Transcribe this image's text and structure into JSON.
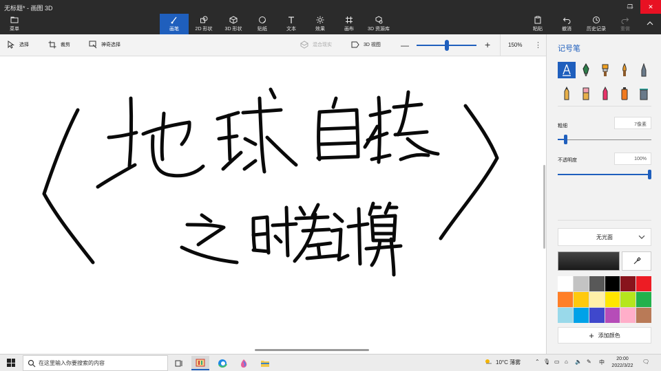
{
  "window": {
    "title": "无标题* - 画图 3D",
    "controls": {
      "minimize": "—",
      "restore": "❐",
      "close": "✕"
    }
  },
  "ribbon": {
    "menu_label": "菜单",
    "tabs": [
      {
        "label": "画笔",
        "icon": "brush-icon",
        "active": true
      },
      {
        "label": "2D 形状",
        "icon": "shapes-2d-icon"
      },
      {
        "label": "3D 形状",
        "icon": "shapes-3d-icon"
      },
      {
        "label": "贴纸",
        "icon": "sticker-icon"
      },
      {
        "label": "文本",
        "icon": "text-icon"
      },
      {
        "label": "效果",
        "icon": "effects-icon"
      },
      {
        "label": "画布",
        "icon": "canvas-icon"
      },
      {
        "label": "3D 资源库",
        "icon": "library-icon"
      }
    ],
    "right": [
      {
        "label": "粘贴",
        "icon": "paste-icon"
      },
      {
        "label": "撤消",
        "icon": "undo-icon"
      },
      {
        "label": "历史记录",
        "icon": "history-icon"
      },
      {
        "label": "重做",
        "icon": "redo-icon",
        "disabled": true
      }
    ]
  },
  "toolbar": {
    "select": "选择",
    "crop": "裁剪",
    "magic_select": "神奇选择",
    "mixed_reality": "混合现实",
    "view_3d": "3D 视图",
    "zoom_value": "150%",
    "zoom_level": 0.5
  },
  "panel": {
    "title": "记号笔",
    "tools_row1": [
      "marker-icon",
      "calligraphy-pen-icon",
      "oil-brush-icon",
      "watercolor-icon",
      "pixel-pen-icon"
    ],
    "tools_row2": [
      "pencil-icon",
      "eraser-icon",
      "crayon-icon",
      "spray-can-icon",
      "fill-bucket-icon"
    ],
    "thickness_label": "粗细",
    "thickness_value": "7像素",
    "thickness_level": 0.07,
    "opacity_label": "不透明度",
    "opacity_value": "100%",
    "opacity_level": 1.0,
    "finish_label": "无光面",
    "add_color": "添加颜色",
    "current_color": "#1a1a1a",
    "palette": [
      "#ffffff",
      "#c3c3c3",
      "#585858",
      "#000000",
      "#88141c",
      "#ed1c24",
      "#ff7f27",
      "#ffc90e",
      "#fff0a8",
      "#ffe600",
      "#b5e61d",
      "#22b14c",
      "#99d9ea",
      "#00a2e8",
      "#3f48cc",
      "#b64cb8",
      "#ffaec9",
      "#b97a57"
    ]
  },
  "taskbar": {
    "search_placeholder": "在这里输入你要搜索的内容",
    "weather": "10°C 薄雾",
    "ime": "中",
    "time": "20:00",
    "date": "2022/3/22"
  },
  "colors": {
    "accent": "#1f5fbd",
    "titlebar": "#2b2b2b"
  }
}
